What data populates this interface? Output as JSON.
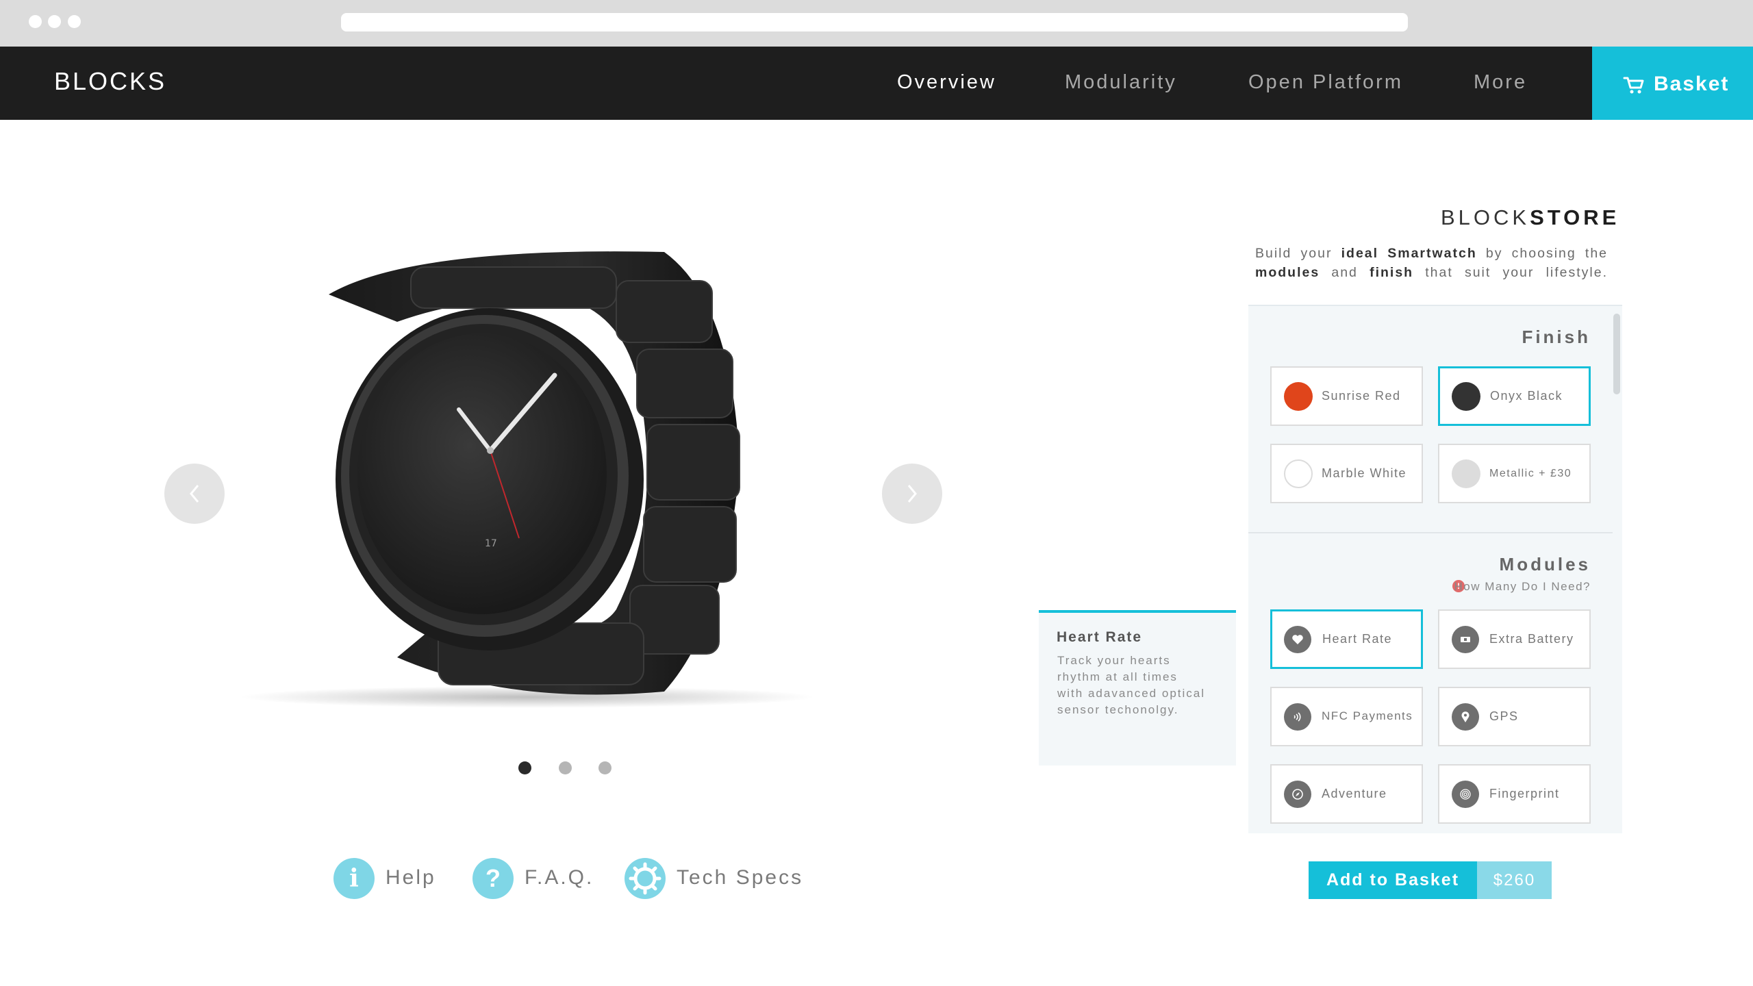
{
  "nav": {
    "logo": "BLOCKS",
    "links": [
      "Overview",
      "Modularity",
      "Open Platform",
      "More"
    ],
    "active": "Overview",
    "basket_label": "Basket"
  },
  "gallery": {
    "slide_count": 3,
    "active_slide": 1,
    "watch_dial_date": "17"
  },
  "footer_links": [
    {
      "label": "Help",
      "icon": "info-icon"
    },
    {
      "label": "F.A.Q.",
      "icon": "question-icon"
    },
    {
      "label": "Tech Specs",
      "icon": "gear-icon"
    }
  ],
  "store": {
    "title_light": "BLOCK",
    "title_bold": "STORE",
    "desc_parts": [
      "Build your ",
      "ideal Smartwatch",
      " by choosing the ",
      "modules",
      " and ",
      "finish",
      " that suit your lifestyle."
    ]
  },
  "finish": {
    "title": "Finish",
    "options": [
      {
        "label": "Sunrise Red",
        "color": "#e0451b",
        "selected": false
      },
      {
        "label": "Onyx Black",
        "color": "#333333",
        "selected": true
      },
      {
        "label": "Marble White",
        "color": "#ffffff",
        "selected": false
      },
      {
        "label": "Metallic + £30",
        "color": "#dcdcdc",
        "selected": false
      }
    ]
  },
  "modules": {
    "title": "Modules",
    "help_link": "How Many Do I Need?",
    "help_icon": "!",
    "options": [
      {
        "label": "Heart Rate",
        "icon": "heart-icon",
        "selected": true
      },
      {
        "label": "Extra Battery",
        "icon": "battery-icon",
        "selected": false
      },
      {
        "label": "NFC Payments",
        "icon": "nfc-icon",
        "selected": false
      },
      {
        "label": "GPS",
        "icon": "location-pin-icon",
        "selected": false
      },
      {
        "label": "Adventure",
        "icon": "compass-icon",
        "selected": false
      },
      {
        "label": "Fingerprint",
        "icon": "fingerprint-icon",
        "selected": false
      }
    ]
  },
  "tooltip": {
    "title": "Heart Rate",
    "body": "Track your hearts rhythm at all times with adavanced optical sensor techonolgy."
  },
  "cta": {
    "add_label": "Add to Basket",
    "price": "$260"
  },
  "colors": {
    "accent": "#15bfd9",
    "accent_light": "#8ad9e8",
    "nav_bg": "#1e1e1e",
    "panel_bg": "#f3f7f9"
  }
}
